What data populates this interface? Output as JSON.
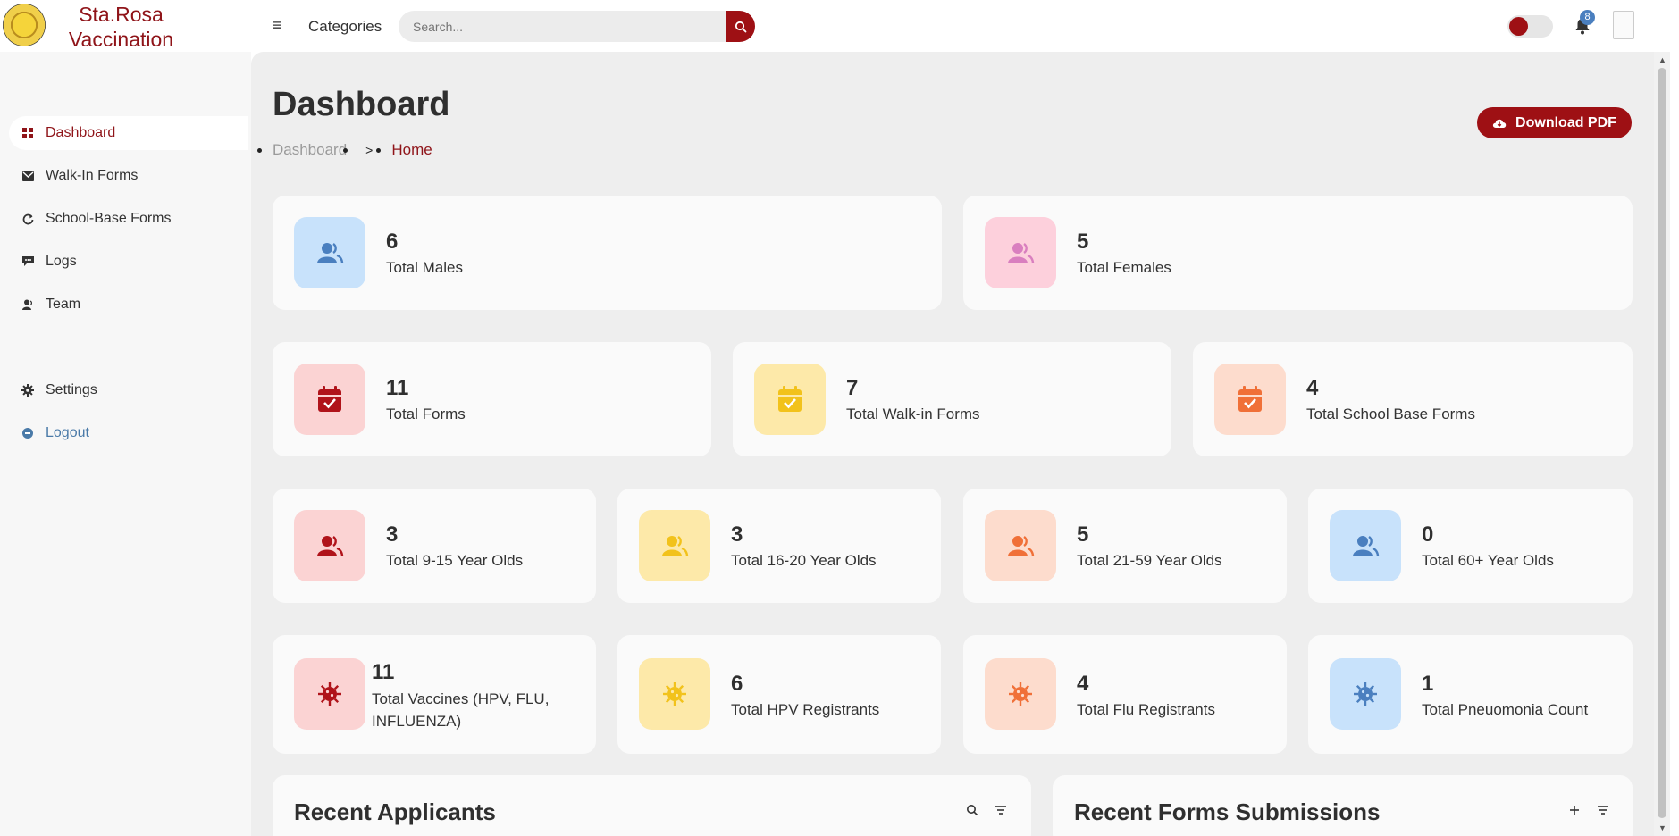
{
  "brand": {
    "line1": "Sta.Rosa",
    "line2": "Vaccination"
  },
  "header": {
    "menu_glyph": "≡",
    "categories_label": "Categories",
    "search_placeholder": "Search...",
    "notification_count": "8"
  },
  "sidebar": {
    "items": [
      {
        "label": "Dashboard",
        "icon": "dashboard-icon"
      },
      {
        "label": "Walk-In Forms",
        "icon": "mail-icon"
      },
      {
        "label": "School-Base Forms",
        "icon": "refresh-icon"
      },
      {
        "label": "Logs",
        "icon": "chat-icon"
      },
      {
        "label": "Team",
        "icon": "user-icon"
      },
      {
        "label": "Settings",
        "icon": "gear-icon"
      },
      {
        "label": "Logout",
        "icon": "logout-icon"
      }
    ]
  },
  "page": {
    "title": "Dashboard",
    "breadcrumb": [
      "Dashboard",
      "Home"
    ],
    "breadcrumb_sep": ">",
    "download_label": "Download PDF"
  },
  "stats": {
    "males": {
      "value": "6",
      "label": "Total Males"
    },
    "females": {
      "value": "5",
      "label": "Total Females"
    },
    "forms": {
      "value": "11",
      "label": "Total Forms"
    },
    "walkin": {
      "value": "7",
      "label": "Total Walk-in Forms"
    },
    "school": {
      "value": "4",
      "label": "Total School Base Forms"
    },
    "age_9_15": {
      "value": "3",
      "label": "Total 9-15 Year Olds"
    },
    "age_16_20": {
      "value": "3",
      "label": "Total 16-20 Year Olds"
    },
    "age_21_59": {
      "value": "5",
      "label": "Total 21-59 Year Olds"
    },
    "age_60": {
      "value": "0",
      "label": "Total 60+ Year Olds"
    },
    "vaccines": {
      "value": "11",
      "label": "Total Vaccines (HPV, FLU, INFLUENZA)"
    },
    "hpv": {
      "value": "6",
      "label": "Total HPV Registrants"
    },
    "flu": {
      "value": "4",
      "label": "Total Flu Registrants"
    },
    "pneumonia": {
      "value": "1",
      "label": "Total Pneuomonia Count"
    }
  },
  "panels": {
    "applicants_title": "Recent Applicants",
    "forms_title": "Recent Forms Submissions"
  },
  "colors": {
    "brand": "#8f1419",
    "accent": "#9e1014",
    "blue": "#4a7fbf",
    "pink": "#d97fbf",
    "yellow": "#f2c21b",
    "orange": "#f07038"
  }
}
